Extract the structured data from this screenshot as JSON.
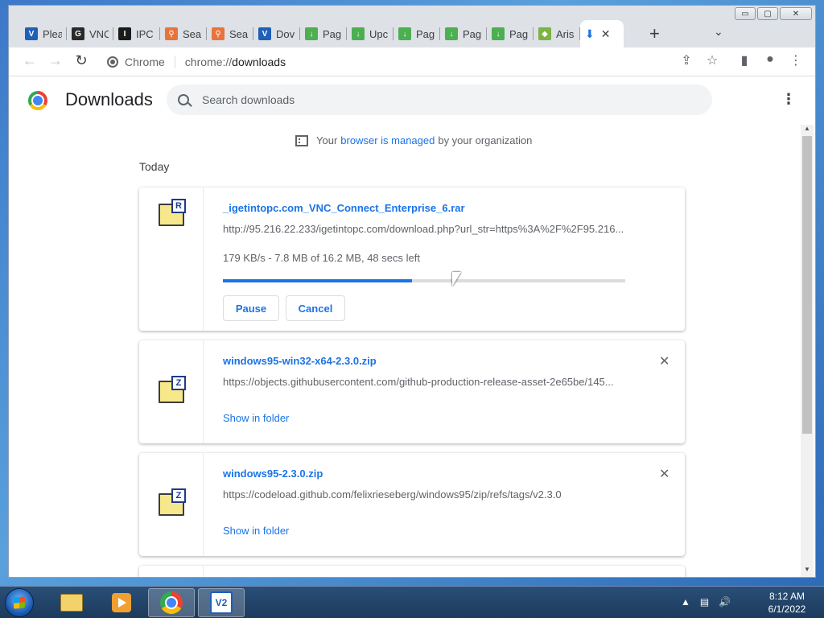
{
  "window": {
    "minimize_label": "▭",
    "maximize_label": "▢",
    "close_label": "✕"
  },
  "tabs": [
    {
      "label": "Plea",
      "icon": "vnc-icon",
      "color": "#1f5fb8",
      "glyph": "V"
    },
    {
      "label": "VNC",
      "icon": "g-icon",
      "color": "#2a2a2a",
      "glyph": "G"
    },
    {
      "label": "IPC",
      "icon": "ipc-icon",
      "color": "#1a1a1a",
      "glyph": "I"
    },
    {
      "label": "Sea",
      "icon": "person-icon",
      "color": "#e8743b",
      "glyph": "⚲"
    },
    {
      "label": "Sea",
      "icon": "person-icon",
      "color": "#e8743b",
      "glyph": "⚲"
    },
    {
      "label": "Dov",
      "icon": "vnc-icon",
      "color": "#1f5fb8",
      "glyph": "V"
    },
    {
      "label": "Pag",
      "icon": "download-page-icon",
      "color": "#4caf50",
      "glyph": "↓"
    },
    {
      "label": "Upc",
      "icon": "download-page-icon",
      "color": "#4caf50",
      "glyph": "↓"
    },
    {
      "label": "Pag",
      "icon": "download-page-icon",
      "color": "#4caf50",
      "glyph": "↓"
    },
    {
      "label": "Pag",
      "icon": "download-page-icon",
      "color": "#4caf50",
      "glyph": "↓"
    },
    {
      "label": "Pag",
      "icon": "download-page-icon",
      "color": "#4caf50",
      "glyph": "↓"
    },
    {
      "label": "Aris",
      "icon": "aria-icon",
      "color": "#7cb342",
      "glyph": "◆"
    }
  ],
  "active_tab": {
    "icon": "download-icon",
    "glyph": "⬇",
    "close": "✕"
  },
  "tabstrip": {
    "new_tab": "+",
    "tab_search": "⌄"
  },
  "toolbar": {
    "back": "←",
    "forward": "→",
    "reload": "↻",
    "site_label": "Chrome",
    "url_scheme": "chrome://",
    "url_host": "downloads",
    "share": "⇪",
    "star": "☆",
    "side_panel": "▮",
    "profile": "●",
    "menu": "⋮"
  },
  "downloads": {
    "title": "Downloads",
    "search_placeholder": "Search downloads",
    "menu": "⋮",
    "managed_prefix": "Your",
    "managed_link": "browser is managed",
    "managed_suffix": "by your organization",
    "section": "Today",
    "items": [
      {
        "name": "_igetintopc.com_VNC_Connect_Enterprise_6.rar",
        "url": "http://95.216.22.233/igetintopc.com/download.php?url_str=https%3A%2F%2F95.216...",
        "status": "179 KB/s - 7.8 MB of 16.2 MB, 48 secs left",
        "progress_fraction": 0.47,
        "badge": "R",
        "pause_label": "Pause",
        "cancel_label": "Cancel"
      },
      {
        "name": "windows95-win32-x64-2.3.0.zip",
        "url": "https://objects.githubusercontent.com/github-production-release-asset-2e65be/145...",
        "badge": "Z",
        "action": "Show in folder",
        "remove": "✕"
      },
      {
        "name": "windows95-2.3.0.zip",
        "url": "https://codeload.github.com/felixrieseberg/windows95/zip/refs/tags/v2.3.0",
        "badge": "Z",
        "action": "Show in folder",
        "remove": "✕"
      }
    ]
  },
  "scrollbar": {
    "up": "▲",
    "down": "▼"
  },
  "taskbar": {
    "time": "8:12 AM",
    "date": "6/1/2022",
    "tray_up": "▲",
    "tray_network": "▤",
    "tray_volume": "🔊",
    "vnc_glyph": "V2"
  }
}
